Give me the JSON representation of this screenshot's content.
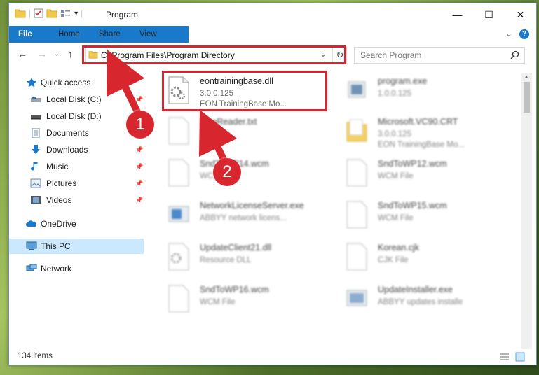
{
  "window": {
    "title": "Program",
    "controls": {
      "minimize": "—",
      "maximize": "☐",
      "close": "✕"
    }
  },
  "ribbon": {
    "tabs": [
      "File",
      "Home",
      "Share",
      "View"
    ],
    "expand": "⌄",
    "help": "?"
  },
  "nav": {
    "back": "←",
    "forward": "→",
    "recent": "⌄",
    "up": "↑",
    "address": "C:\\Program Files\\Program Directory",
    "address_dropdown": "⌄",
    "refresh": "↻",
    "search_placeholder": "Search Program"
  },
  "sidebar": {
    "items": [
      {
        "label": "Quick access",
        "icon": "star-icon",
        "pinned": false
      },
      {
        "label": "Local Disk (C:)",
        "icon": "drive-icon",
        "pinned": true
      },
      {
        "label": "Local Disk (D:)",
        "icon": "drive-icon",
        "pinned": true
      },
      {
        "label": "Documents",
        "icon": "documents-icon",
        "pinned": true
      },
      {
        "label": "Downloads",
        "icon": "downloads-icon",
        "pinned": true
      },
      {
        "label": "Music",
        "icon": "music-icon",
        "pinned": true
      },
      {
        "label": "Pictures",
        "icon": "pictures-icon",
        "pinned": true
      },
      {
        "label": "Videos",
        "icon": "videos-icon",
        "pinned": true
      },
      {
        "label": "OneDrive",
        "icon": "onedrive-icon",
        "pinned": false
      },
      {
        "label": "This PC",
        "icon": "pc-icon",
        "pinned": false,
        "selected": true
      },
      {
        "label": "Network",
        "icon": "network-icon",
        "pinned": false
      }
    ]
  },
  "files": [
    {
      "name": "eontrainingbase.dll",
      "line2": "3.0.0.125",
      "line3": "EON TrainingBase Mo...",
      "icon": "dll-gear-icon",
      "highlighted": true
    },
    {
      "name": "program.exe",
      "line2": "1.0.0.125",
      "line3": "",
      "icon": "exe-icon"
    },
    {
      "name": "FineReader.txt",
      "line2": "TXT File",
      "line3": "",
      "icon": "text-file-icon"
    },
    {
      "name": "Microsoft.VC90.CRT",
      "line2": "3.0.0.125",
      "line3": "EON TrainingBase Mo...",
      "icon": "folder-icon"
    },
    {
      "name": "SndToWP14.wcm",
      "line2": "WCM File",
      "line3": "",
      "icon": "blank-file-icon"
    },
    {
      "name": "SndToWP12.wcm",
      "line2": "WCM File",
      "line3": "",
      "icon": "blank-file-icon"
    },
    {
      "name": "NetworkLicenseServer.exe",
      "line2": "ABBYY network licens...",
      "line3": "",
      "icon": "app-window-icon"
    },
    {
      "name": "SndToWP15.wcm",
      "line2": "WCM File",
      "line3": "",
      "icon": "blank-file-icon"
    },
    {
      "name": "UpdateClient21.dll",
      "line2": "Resource DLL",
      "line3": "",
      "icon": "dll-gear-icon"
    },
    {
      "name": "Korean.cjk",
      "line2": "CJK File",
      "line3": "",
      "icon": "blank-file-icon"
    },
    {
      "name": "SndToWP16.wcm",
      "line2": "WCM File",
      "line3": "",
      "icon": "blank-file-icon"
    },
    {
      "name": "UpdateInstaller.exe",
      "line2": "ABBYY updates installe",
      "line3": "",
      "icon": "app-window-icon"
    }
  ],
  "status": {
    "count": "134 items"
  },
  "annotations": {
    "step1": "1",
    "step2": "2"
  },
  "colors": {
    "accent": "#1979ca",
    "highlight": "#d8262f",
    "selected": "#cce8ff"
  }
}
